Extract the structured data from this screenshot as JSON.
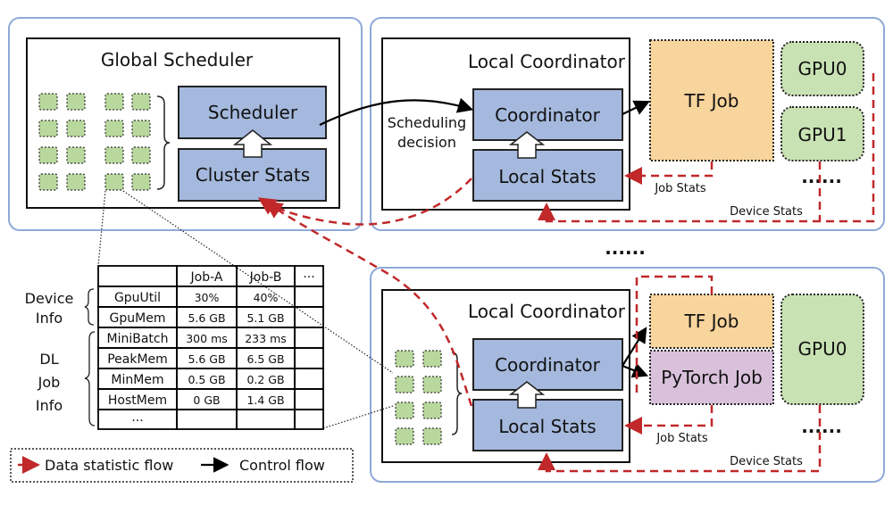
{
  "colors": {
    "panel_border": "#8fa9d8",
    "component_fill": "#a5b9de",
    "tf_job_fill": "#f8d59c",
    "pytorch_job_fill": "#d9c1dc",
    "gpu_fill": "#c9e2b3",
    "data_flow": "#c0282a",
    "control_flow": "#000000"
  },
  "global": {
    "title": "Global Scheduler",
    "scheduler": "Scheduler",
    "cluster_stats": "Cluster Stats"
  },
  "node1": {
    "title": "Local Coordinator",
    "coordinator": "Coordinator",
    "local_stats": "Local Stats",
    "decision_line1": "Scheduling",
    "decision_line2": "decision",
    "job": "TF Job",
    "gpu0": "GPU0",
    "gpu1": "GPU1",
    "more": "......",
    "job_stats": "Job Stats",
    "device_stats": "Device Stats"
  },
  "between_nodes": "......",
  "node2": {
    "title": "Local Coordinator",
    "coordinator": "Coordinator",
    "local_stats": "Local Stats",
    "job1": "TF Job",
    "job2": "PyTorch Job",
    "gpu0": "GPU0",
    "more": "......",
    "job_stats": "Job Stats",
    "device_stats": "Device Stats"
  },
  "table": {
    "headers": [
      "",
      "Job-A",
      "Job-B",
      "···"
    ],
    "groups": {
      "device_line1": "Device",
      "device_line2": "Info",
      "dl_line1": "DL",
      "dl_line2": "Job",
      "dl_line3": "Info"
    },
    "rows": [
      [
        "GpuUtil",
        "30%",
        "40%",
        ""
      ],
      [
        "GpuMem",
        "5.6 GB",
        "5.1 GB",
        ""
      ],
      [
        "MiniBatch",
        "300 ms",
        "233 ms",
        ""
      ],
      [
        "PeakMem",
        "5.6 GB",
        "6.5 GB",
        ""
      ],
      [
        "MinMem",
        "0.5 GB",
        "0.2 GB",
        ""
      ],
      [
        "HostMem",
        "0 GB",
        "1.4 GB",
        ""
      ],
      [
        "···",
        "",
        "",
        ""
      ]
    ]
  },
  "legend": {
    "data_flow": "Data statistic flow",
    "control_flow": "Control flow"
  }
}
